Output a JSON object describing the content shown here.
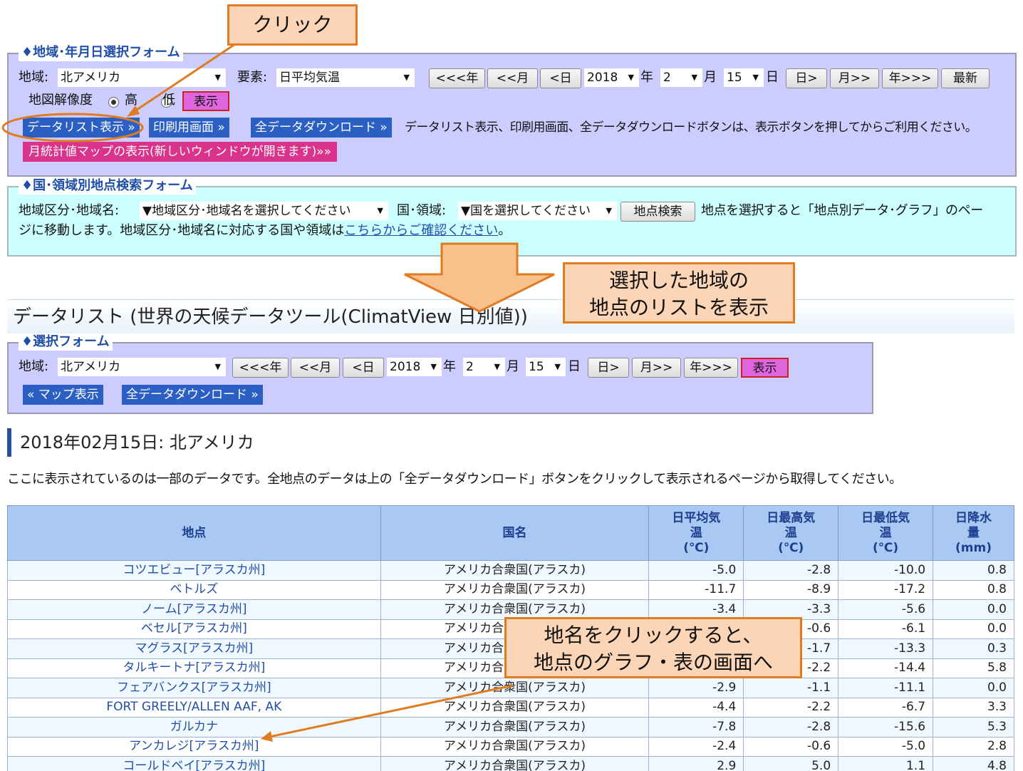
{
  "annotations": {
    "click": "クリック",
    "show_list_line1": "選択した地域の",
    "show_list_line2": "地点のリストを表示",
    "station_click_line1": "地名をクリックすると、",
    "station_click_line2": "地点のグラフ・表の画面へ"
  },
  "colors": {
    "annotation_fill": "#fbd5b5",
    "annotation_border": "#e07b20",
    "form_purple": "#ccccff",
    "form_cyan": "#ccffff",
    "button_blue": "#2b5fc4",
    "button_pink": "#d9338c",
    "table_header": "#a9c9f4"
  },
  "form1": {
    "legend": "♦地域･年月日選択フォーム",
    "region_label": "地域:",
    "region_value": "北アメリカ",
    "element_label": "要素:",
    "element_value": "日平均気温",
    "nav_prev_year": "<<<年",
    "nav_prev_month": "<<月",
    "nav_prev_day": "<日",
    "year_value": "2018",
    "year_unit": "年",
    "month_value": "2",
    "month_unit": "月",
    "day_value": "15",
    "day_unit": "日",
    "nav_next_day": "日>",
    "nav_next_month": "月>>",
    "nav_next_year": "年>>>",
    "latest": "最新",
    "resolution_label": "地図解像度",
    "res_high": "高",
    "res_low": "低",
    "show_button": "表示",
    "datalist_button": "データリスト表示 »",
    "print_button": "印刷用画面 »",
    "download_button": "全データダウンロード »",
    "note": "データリスト表示、印刷用画面、全データダウンロードボタンは、表示ボタンを押してからご利用ください。",
    "monthly_map_button": "月統計値マップの表示(新しいウィンドウが開きます)»»"
  },
  "form2": {
    "legend": "♦国･領域別地点検索フォーム",
    "area_label": "地域区分･地域名:",
    "area_value": "▼地域区分･地域名を選択してください",
    "country_label": "国･領域:",
    "country_value": "▼国を選択してください",
    "search_button": "地点検索",
    "desc_part1": "地点を選択すると「地点別データ･グラフ」のペー",
    "desc_part2": "ジに移動します。地域区分･地域名に対応する国や領域は",
    "desc_link": "こちらからご確認ください",
    "desc_end": "。"
  },
  "page_title": "データリスト (世界の天候データツール(ClimatView 日別値))",
  "form3": {
    "legend": "♦選択フォーム",
    "region_label": "地域:",
    "region_value": "北アメリカ",
    "nav_prev_year": "<<<年",
    "nav_prev_month": "<<月",
    "nav_prev_day": "<日",
    "year_value": "2018",
    "year_unit": "年",
    "month_value": "2",
    "month_unit": "月",
    "day_value": "15",
    "day_unit": "日",
    "nav_next_day": "日>",
    "nav_next_month": "月>>",
    "nav_next_year": "年>>>",
    "show_button": "表示",
    "map_button": "« マップ表示",
    "download_button": "全データダウンロード »"
  },
  "section_heading": "2018年02月15日: 北アメリカ",
  "notice": "ここに表示されているのは一部のデータです。全地点のデータは上の「全データダウンロード」ボタンをクリックして表示されるページから取得してください。",
  "table": {
    "headers": {
      "station": "地点",
      "country": "国名",
      "mean_l1": "日平均気",
      "mean_l2": "温",
      "mean_l3": "(℃)",
      "max_l1": "日最高気",
      "max_l2": "温",
      "max_l3": "(℃)",
      "min_l1": "日最低気",
      "min_l2": "温",
      "min_l3": "(℃)",
      "precip_l1": "日降水",
      "precip_l2": "量",
      "precip_l3": "(mm)"
    },
    "rows": [
      {
        "station": "コツエビュー[アラスカ州]",
        "country": "アメリカ合衆国(アラスカ)",
        "mean": "-5.0",
        "max": "-2.8",
        "min": "-10.0",
        "precip": "0.8"
      },
      {
        "station": "ベトルズ",
        "country": "アメリカ合衆国(アラスカ)",
        "mean": "-11.7",
        "max": "-8.9",
        "min": "-17.2",
        "precip": "0.8"
      },
      {
        "station": "ノーム[アラスカ州]",
        "country": "アメリカ合衆国(アラスカ)",
        "mean": "-3.4",
        "max": "-3.3",
        "min": "-5.6",
        "precip": "0.0"
      },
      {
        "station": "ベセル[アラスカ州]",
        "country": "アメリカ合衆国(アラスカ)",
        "mean": "",
        "max": "-0.6",
        "min": "-6.1",
        "precip": "0.0"
      },
      {
        "station": "マグラス[アラスカ州]",
        "country": "アメリカ合衆国(アラスカ)",
        "mean": "",
        "max": "-1.7",
        "min": "-13.3",
        "precip": "0.3"
      },
      {
        "station": "タルキートナ[アラスカ州]",
        "country": "アメリカ合衆国(アラスカ)",
        "mean": "",
        "max": "-2.2",
        "min": "-14.4",
        "precip": "5.8"
      },
      {
        "station": "フェアバンクス[アラスカ州]",
        "country": "アメリカ合衆国(アラスカ)",
        "mean": "-2.9",
        "max": "-1.1",
        "min": "-11.1",
        "precip": "0.0"
      },
      {
        "station": "FORT GREELY/ALLEN AAF, AK",
        "country": "アメリカ合衆国(アラスカ)",
        "mean": "-4.4",
        "max": "-2.2",
        "min": "-6.7",
        "precip": "3.3"
      },
      {
        "station": "ガルカナ",
        "country": "アメリカ合衆国(アラスカ)",
        "mean": "-7.8",
        "max": "-2.8",
        "min": "-15.6",
        "precip": "5.3"
      },
      {
        "station": "アンカレジ[アラスカ州]",
        "country": "アメリカ合衆国(アラスカ)",
        "mean": "-2.4",
        "max": "-0.6",
        "min": "-5.0",
        "precip": "2.8"
      },
      {
        "station": "コールドベイ[アラスカ州]",
        "country": "アメリカ合衆国(アラスカ)",
        "mean": "2.9",
        "max": "5.0",
        "min": "1.1",
        "precip": "4.8"
      }
    ]
  }
}
